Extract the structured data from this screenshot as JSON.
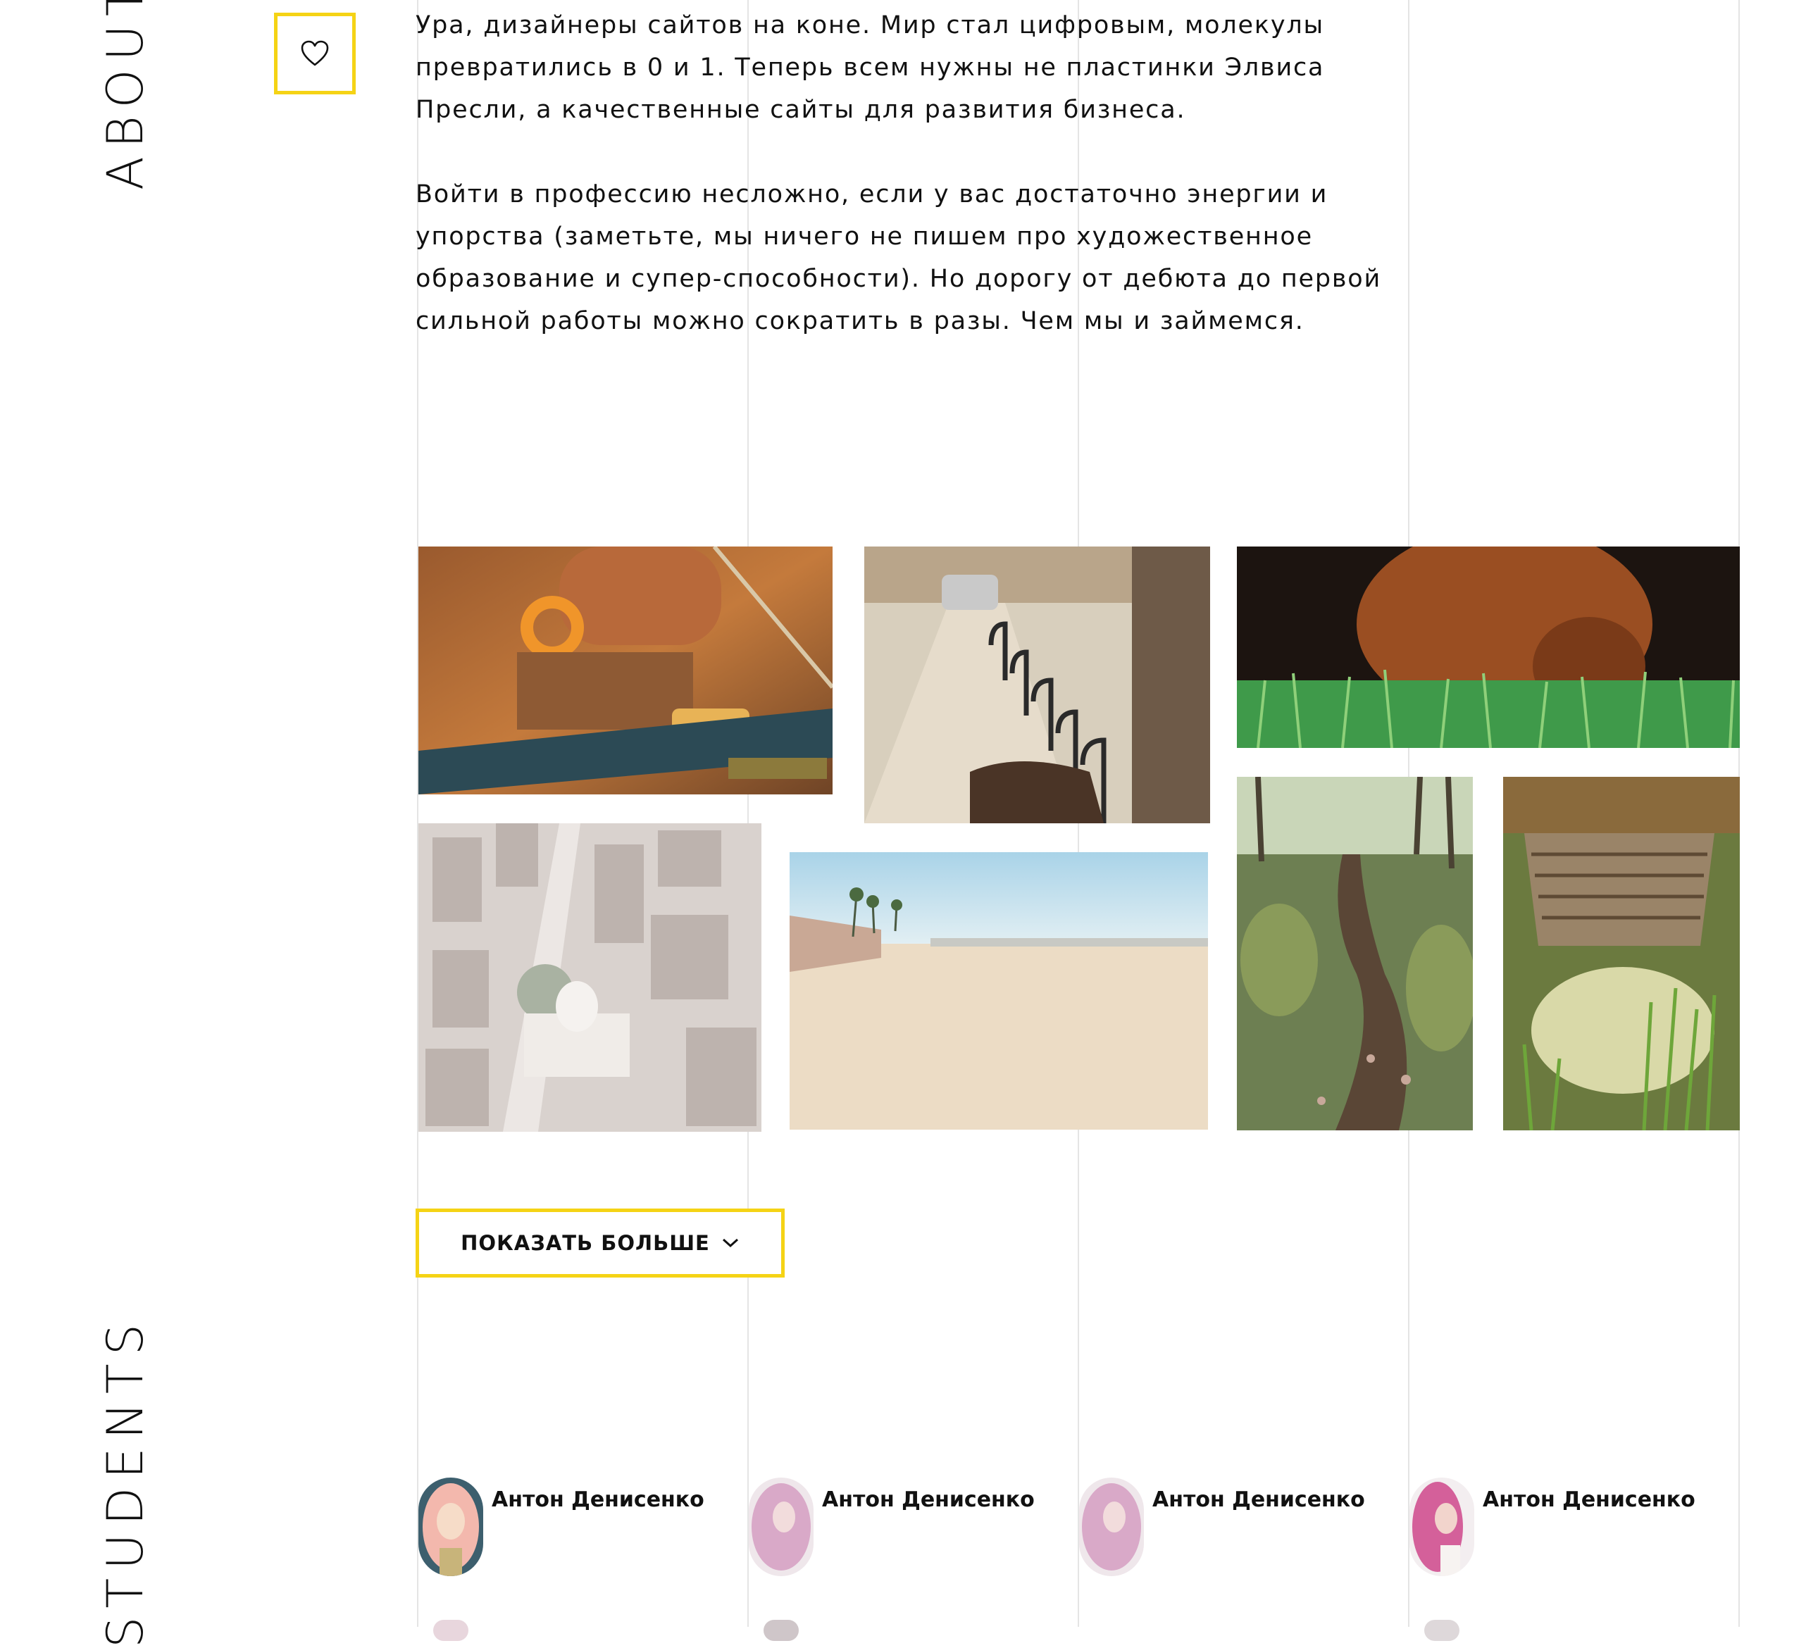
{
  "sections": {
    "about_title": "ABOUT",
    "students_title": "STUDENTS"
  },
  "about": {
    "paragraph_1": "Ура, дизайнеры сайтов на коне. Мир стал цифровым, молекулы превратились в 0 и 1. Теперь всем нужны не пластинки Элвиса Пресли, а качественные сайты для развития бизнеса.",
    "paragraph_2": "Войти в профессию несложно, если у вас достаточно энергии и упорства (заметьте, мы ничего не пишем про художественное образование и супер-способности). Но дорогу от дебюта до первой сильной работы можно сократить в разы. Чем мы и займемся."
  },
  "gallery": {
    "show_more_label": "ПОКАЗАТЬ БОЛЬШЕ",
    "photos": [
      "boat",
      "bicycles-street",
      "dog-grass",
      "city-aerial",
      "beach",
      "forest-path",
      "wooden-pier"
    ]
  },
  "students": [
    {
      "name": "Антон Денисенко",
      "avatar": "blonde-pink-hair"
    },
    {
      "name": "Антон Денисенко",
      "avatar": "pink-hair"
    },
    {
      "name": "Антон Денисенко",
      "avatar": "pink-hair"
    },
    {
      "name": "Антон Денисенко",
      "avatar": "pink-hair-portrait"
    }
  ],
  "colors": {
    "accent": "#f5d315",
    "text": "#111111",
    "guide": "#e4e4e4"
  },
  "icons": {
    "favorite": "heart-icon",
    "expand": "chevron-down-icon"
  }
}
